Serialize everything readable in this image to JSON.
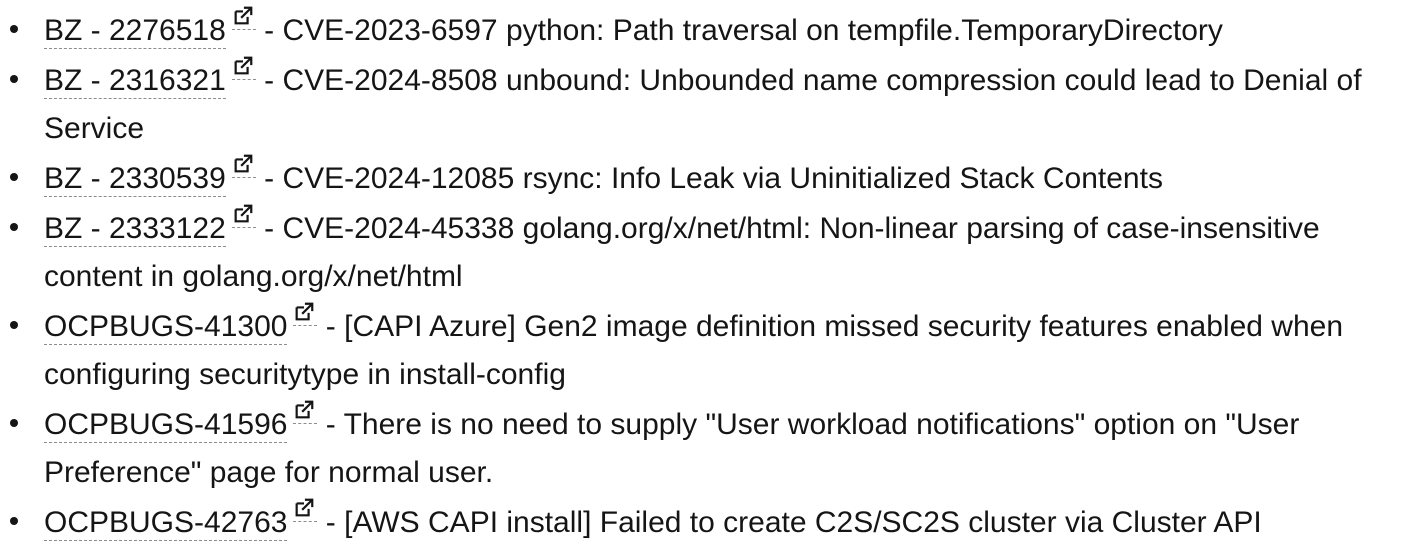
{
  "fixed_issues": [
    {
      "id": "BZ - 2276518",
      "icon": "external-link-icon",
      "separator": " - ",
      "description": "CVE-2023-6597 python: Path traversal on tempfile.TemporaryDirectory"
    },
    {
      "id": "BZ - 2316321",
      "icon": "external-link-icon",
      "separator": " - ",
      "description": "CVE-2024-8508 unbound: Unbounded name compression could lead to Denial of Service"
    },
    {
      "id": "BZ - 2330539",
      "icon": "external-link-icon",
      "separator": " - ",
      "description": "CVE-2024-12085 rsync: Info Leak via Uninitialized Stack Contents"
    },
    {
      "id": "BZ - 2333122",
      "icon": "external-link-icon",
      "separator": " - ",
      "description": "CVE-2024-45338 golang.org/x/net/html: Non-linear parsing of case-insensitive content in golang.org/x/net/html"
    },
    {
      "id": "OCPBUGS-41300",
      "icon": "external-link-icon",
      "separator": " - ",
      "description": "[CAPI Azure] Gen2 image definition missed security features enabled when configuring securitytype in install-config"
    },
    {
      "id": "OCPBUGS-41596",
      "icon": "external-link-icon",
      "separator": " - ",
      "description": "There is no need to supply \"User workload notifications\" option on \"User Preference\" page for normal user."
    },
    {
      "id": "OCPBUGS-42763",
      "icon": "external-link-icon",
      "separator": " - ",
      "description": "[AWS CAPI install] Failed to create C2S/SC2S cluster via Cluster API"
    }
  ]
}
